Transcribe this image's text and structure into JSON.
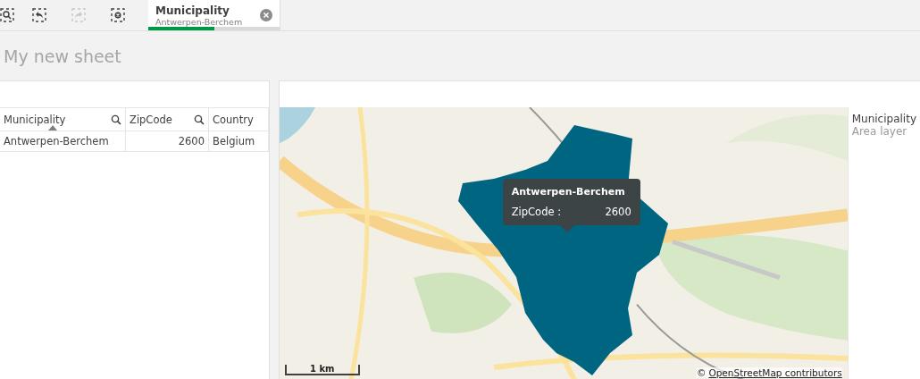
{
  "toolbar": {
    "buttons": [
      {
        "kind": "search",
        "disabled": false
      },
      {
        "kind": "back",
        "disabled": false
      },
      {
        "kind": "forward",
        "disabled": true
      },
      {
        "kind": "clear",
        "disabled": false
      }
    ]
  },
  "selection": {
    "field": "Municipality",
    "value": "Antwerpen-Berchem",
    "level": 0.5
  },
  "sheet": {
    "title": "My new sheet"
  },
  "table": {
    "columns": [
      {
        "label": "Municipality",
        "searchable": true,
        "sorted": true
      },
      {
        "label": "ZipCode",
        "searchable": true,
        "sorted": false
      },
      {
        "label": "Country",
        "searchable": false,
        "sorted": false
      }
    ],
    "rows": [
      [
        "Antwerpen-Berchem",
        "2600",
        "Belgium"
      ]
    ]
  },
  "map": {
    "tooltip": {
      "title": "Antwerpen-Berchem",
      "label": "ZipCode :",
      "value": "2600"
    },
    "scale": "1 km",
    "attribution_prefix": "©",
    "attribution": "OpenStreetMap contributors",
    "legend": {
      "title": "Municipality",
      "subtitle": "Area layer"
    }
  }
}
